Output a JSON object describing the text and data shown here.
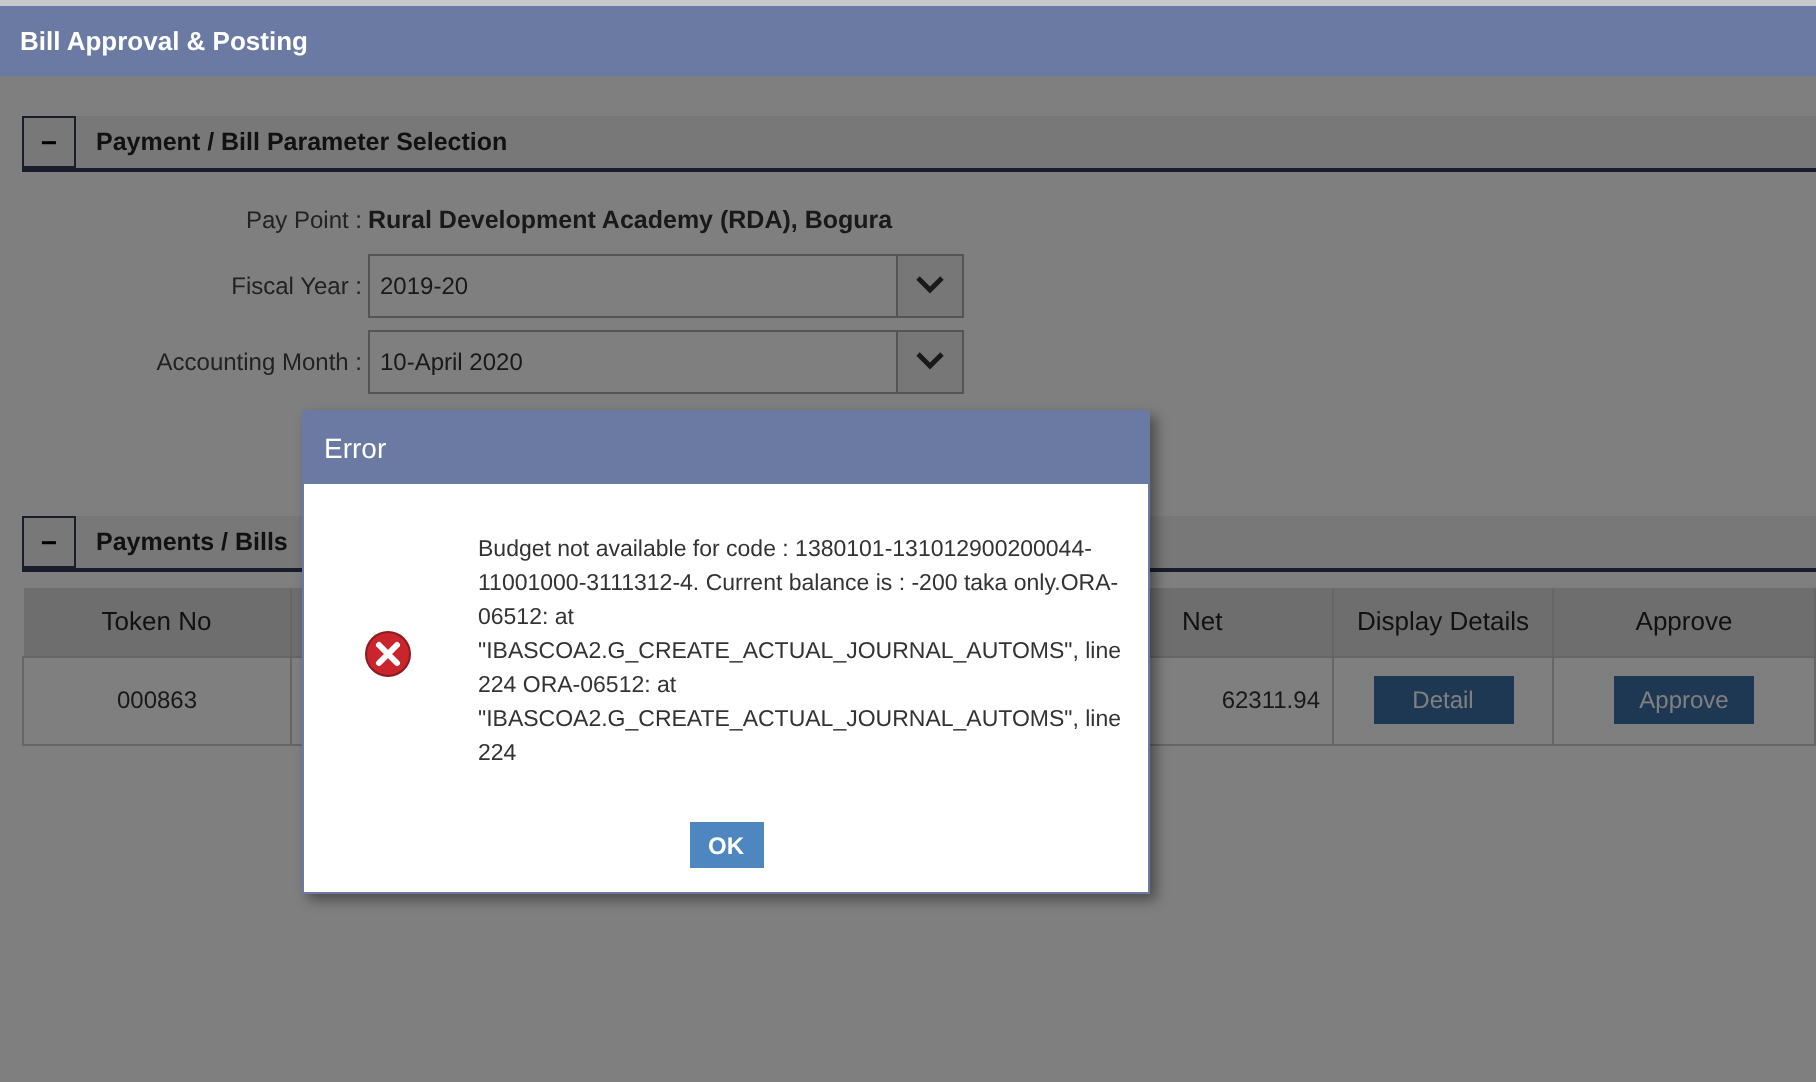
{
  "window": {
    "title": "Bill Approval & Posting"
  },
  "parameter_section": {
    "toggle": "−",
    "title": "Payment / Bill Parameter Selection",
    "fields": [
      {
        "kind": "text",
        "label": "Pay Point :",
        "value": "Rural Development Academy (RDA), Bogura"
      },
      {
        "kind": "select",
        "label": "Fiscal Year :",
        "value": "2019-20"
      },
      {
        "kind": "select",
        "label": "Accounting Month :",
        "value": "10-April 2020"
      }
    ]
  },
  "bills_section": {
    "toggle": "−",
    "title": "Payments / Bills",
    "table": {
      "columns": [
        "Token No",
        "Net",
        "Display Details",
        "Approve"
      ],
      "rows": [
        {
          "token_no": "000863",
          "net": "62311.94",
          "detail_button": "Detail",
          "approve_button": "Approve"
        }
      ]
    }
  },
  "dialog": {
    "title": "Error",
    "message": "Budget not available for code : 1380101-131012900200044-11001000-3111312-4. Current balance is : -200 taka only.ORA-06512: at \"IBASCOA2.G_CREATE_ACTUAL_JOURNAL_AUTOMS\", line 224 ORA-06512: at \"IBASCOA2.G_CREATE_ACTUAL_JOURNAL_AUTOMS\", line 224",
    "button": "OK"
  }
}
